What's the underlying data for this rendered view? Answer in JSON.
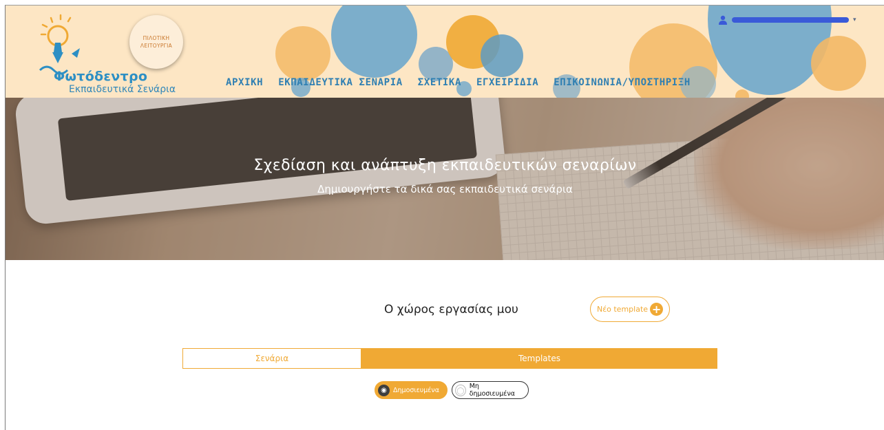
{
  "header": {
    "logo_title": "Φωτόδεντρο",
    "logo_subtitle": "Εκπαιδευτικά Σενάρια",
    "badge_line1": "ΠΙΛΟΤΙΚΗ",
    "badge_line2": "ΛΕΙΤΟΥΡΓΙΑ",
    "nav": [
      {
        "label": "ΑΡΧΙΚΗ"
      },
      {
        "label": "ΕΚΠΑΙΔΕΥΤΙΚΑ ΣΕΝΑΡΙΑ"
      },
      {
        "label": "ΣΧΕΤΙΚΑ"
      },
      {
        "label": "ΕΓΧΕΙΡΙΔΙΑ"
      },
      {
        "label": "ΕΠΙΚΟΙΝΩΝΙΑ/ΥΠΟΣΤΗΡΙΞΗ"
      }
    ],
    "user_icon": "user-icon",
    "accent_orange": "#f0a934",
    "accent_blue": "#2f7fb2"
  },
  "hero": {
    "title": "Σχεδίαση και ανάπτυξη εκπαιδευτικών σεναρίων",
    "subtitle": "Δημιουργήστε τα δικά σας εκπαιδευτικά σενάρια"
  },
  "workspace": {
    "title": "Ο χώρος εργασίας μου",
    "new_template_label": "Νέο template",
    "tabs": [
      {
        "label": "Σενάρια",
        "active": false
      },
      {
        "label": "Templates",
        "active": true
      }
    ],
    "filters": [
      {
        "label": "Δημοσιευμένα",
        "active": true
      },
      {
        "label": "Μη δημοσιευμένα",
        "active": false
      }
    ]
  }
}
